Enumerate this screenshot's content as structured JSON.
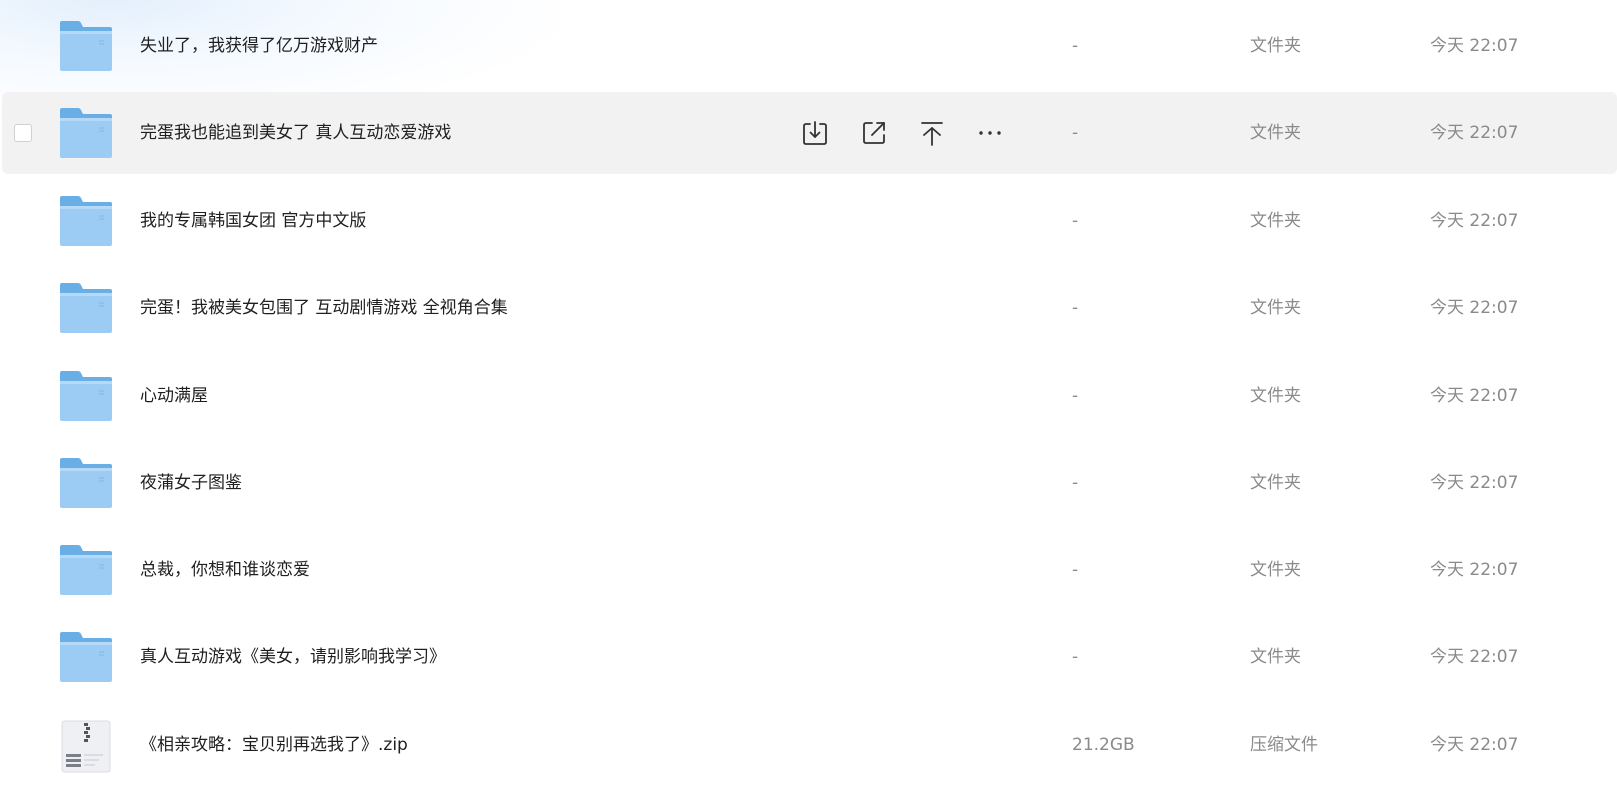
{
  "files": [
    {
      "name": "失业了，我获得了亿万游戏财产",
      "size": "-",
      "type": "文件夹",
      "modified": "今天 22:07",
      "icon": "folder-icon"
    },
    {
      "name": "完蛋我也能追到美女了 真人互动恋爱游戏",
      "size": "-",
      "type": "文件夹",
      "modified": "今天 22:07",
      "icon": "folder-icon",
      "hovered": true
    },
    {
      "name": "我的专属韩国女团 官方中文版",
      "size": "-",
      "type": "文件夹",
      "modified": "今天 22:07",
      "icon": "folder-icon"
    },
    {
      "name": "完蛋！我被美女包围了 互动剧情游戏 全视角合集",
      "size": "-",
      "type": "文件夹",
      "modified": "今天 22:07",
      "icon": "folder-icon"
    },
    {
      "name": "心动满屋",
      "size": "-",
      "type": "文件夹",
      "modified": "今天 22:07",
      "icon": "folder-icon"
    },
    {
      "name": "夜蒲女子图鉴",
      "size": "-",
      "type": "文件夹",
      "modified": "今天 22:07",
      "icon": "folder-icon"
    },
    {
      "name": "总裁，你想和谁谈恋爱",
      "size": "-",
      "type": "文件夹",
      "modified": "今天 22:07",
      "icon": "folder-icon"
    },
    {
      "name": "真人互动游戏《美女，请别影响我学习》",
      "size": "-",
      "type": "文件夹",
      "modified": "今天 22:07",
      "icon": "folder-icon"
    },
    {
      "name": "《相亲攻略：宝贝别再选我了》.zip",
      "size": "21.2GB",
      "type": "压缩文件",
      "modified": "今天 22:07",
      "icon": "zip-file-icon"
    }
  ],
  "row_actions": [
    {
      "icon": "download-icon"
    },
    {
      "icon": "share-icon"
    },
    {
      "icon": "pin-to-top-icon"
    },
    {
      "icon": "more-icon"
    }
  ],
  "colors": {
    "hover_row": "#f2f2f2",
    "name_text": "#1f1f1f",
    "meta_text": "#8a8a8a",
    "folder_front": "#9ccbf4",
    "folder_back": "#6aaee6"
  }
}
